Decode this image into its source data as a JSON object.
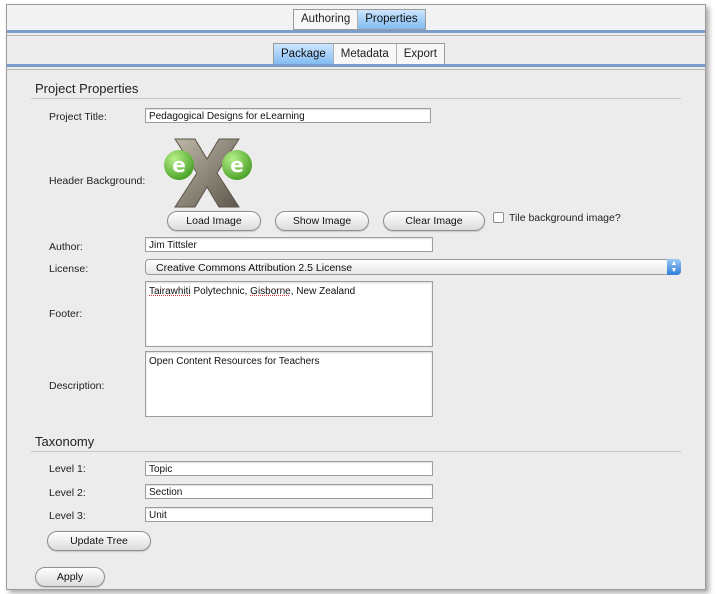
{
  "top_tabs": [
    {
      "label": "Authoring",
      "active": false
    },
    {
      "label": "Properties",
      "active": true
    }
  ],
  "sub_tabs": [
    {
      "label": "Package",
      "active": true
    },
    {
      "label": "Metadata",
      "active": false
    },
    {
      "label": "Export",
      "active": false
    }
  ],
  "project": {
    "section_title": "Project Properties",
    "title_label": "Project Title:",
    "title_value": "Pedagogical Designs for eLearning",
    "header_bg_label": "Header Background:",
    "load_image": "Load Image",
    "show_image": "Show Image",
    "clear_image": "Clear Image",
    "tile_label": "Tile background image?",
    "tile_checked": false,
    "author_label": "Author:",
    "author_value": "Jim Tittsler",
    "license_label": "License:",
    "license_value": "Creative Commons Attribution 2.5 License",
    "footer_label": "Footer:",
    "footer_part1": "Tairawhiti",
    "footer_part2": " Polytechnic, ",
    "footer_part3": "Gisborne",
    "footer_part4": ", New Zealand",
    "description_label": "Description:",
    "description_value": "Open Content Resources for Teachers"
  },
  "taxonomy": {
    "section_title": "Taxonomy",
    "level1_label": "Level 1:",
    "level1_value": "Topic",
    "level2_label": "Level 2:",
    "level2_value": "Section",
    "level3_label": "Level 3:",
    "level3_value": "Unit",
    "update_tree": "Update Tree"
  },
  "apply_label": "Apply",
  "colors": {
    "accent": "#7fbaf2",
    "logo_green": "#5ab132"
  }
}
